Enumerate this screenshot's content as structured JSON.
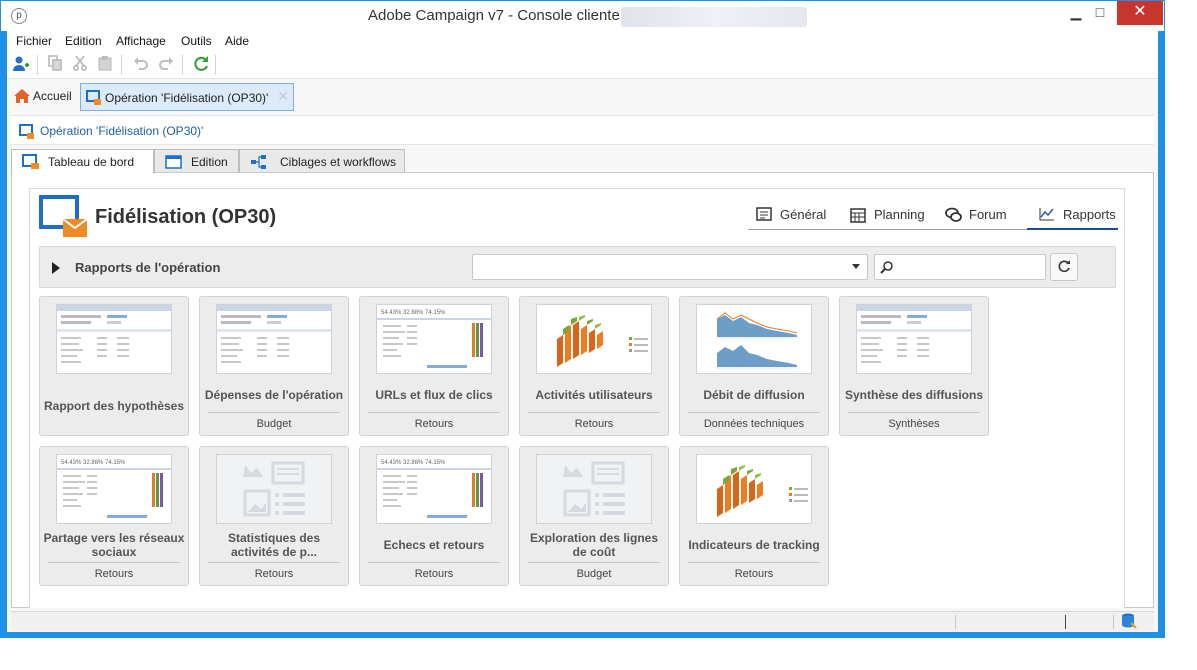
{
  "window": {
    "title": "Adobe Campaign v7 - Console cliente",
    "minimize": "▁",
    "maximize": "□",
    "close": "✕"
  },
  "menu": [
    "Fichier",
    "Edition",
    "Affichage",
    "Outils",
    "Aide"
  ],
  "toolbar": {
    "buttons": [
      "new-user-icon",
      "copy-icon",
      "cut-icon",
      "paste-icon",
      "undo-icon",
      "redo-icon",
      "refresh-icon"
    ]
  },
  "doc_tabs": {
    "home": "Accueil",
    "active": "Opération 'Fidélisation (OP30)'"
  },
  "breadcrumb": "Opération 'Fidélisation (OP30)'",
  "sub_tabs": [
    "Tableau de bord",
    "Edition",
    "Ciblages et workflows"
  ],
  "operation": {
    "title": "Fidélisation (OP30)"
  },
  "nav": [
    "Général",
    "Planning",
    "Forum",
    "Rapports"
  ],
  "section": {
    "title": "Rapports de l'opération",
    "select_value": "",
    "search_placeholder": ""
  },
  "reports": [
    {
      "name": "Rapport des hypothèses",
      "category": "",
      "thumb": "table"
    },
    {
      "name": "Dépenses de l'opération",
      "category": "Budget",
      "thumb": "table"
    },
    {
      "name": "URLs et flux de clics",
      "category": "Retours",
      "thumb": "stats"
    },
    {
      "name": "Activités utilisateurs",
      "category": "Retours",
      "thumb": "bars3d"
    },
    {
      "name": "Débit de diffusion",
      "category": "Données techniques",
      "thumb": "area"
    },
    {
      "name": "Synthèse des diffusions",
      "category": "Synthèses",
      "thumb": "table"
    },
    {
      "name": "Partage vers les réseaux sociaux",
      "category": "Retours",
      "thumb": "stats"
    },
    {
      "name": "Statistiques des activités de p...",
      "category": "Retours",
      "thumb": "placeholder"
    },
    {
      "name": "Echecs et retours",
      "category": "Retours",
      "thumb": "stats"
    },
    {
      "name": "Exploration des lignes de coût",
      "category": "Budget",
      "thumb": "placeholder"
    },
    {
      "name": "Indicateurs de tracking",
      "category": "Retours",
      "thumb": "bars3d"
    }
  ],
  "colors": {
    "window_border": "#1e90e6",
    "accent": "#1f5fa8",
    "orange": "#f07c1e",
    "green": "#7aa63a",
    "close_red": "#c7352d"
  }
}
